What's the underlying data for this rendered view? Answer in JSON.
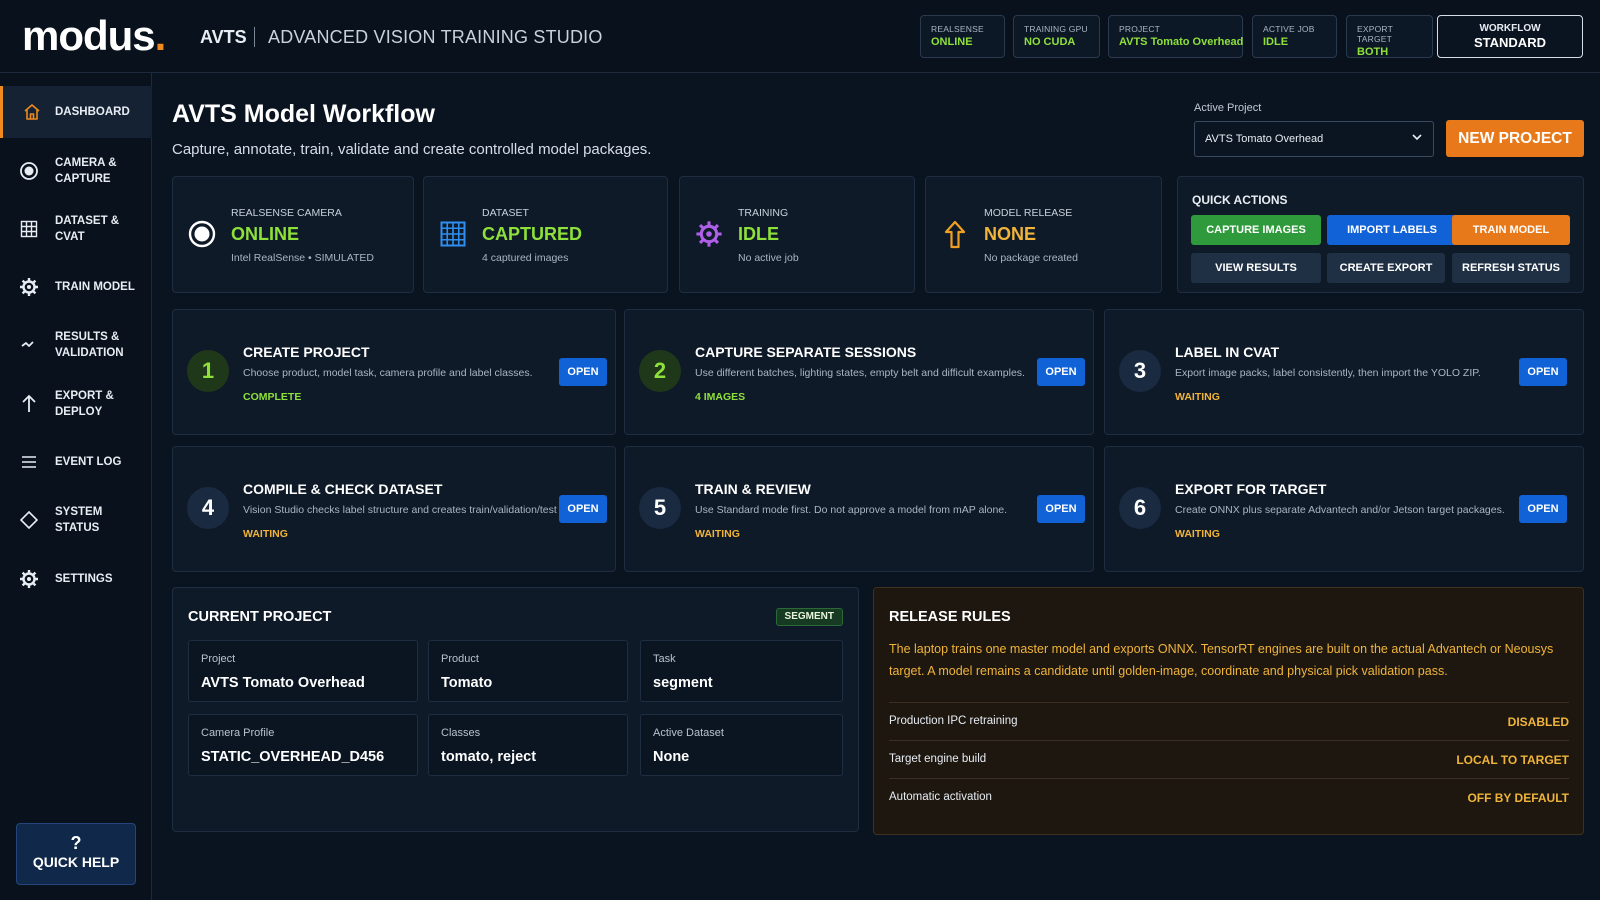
{
  "brand": {
    "logo": "modus",
    "logo_dot": ".",
    "app_name": "AVTS",
    "app_subtitle": "ADVANCED VISION TRAINING STUDIO"
  },
  "topbar": {
    "pills": [
      {
        "label": "REALSENSE",
        "value": "ONLINE"
      },
      {
        "label": "TRAINING GPU",
        "value": "NO CUDA"
      },
      {
        "label": "PROJECT",
        "value": "AVTS Tomato Overhead"
      },
      {
        "label": "ACTIVE JOB",
        "value": "IDLE"
      },
      {
        "label": "EXPORT TARGET",
        "value": "BOTH"
      }
    ],
    "workflow": {
      "label": "WORKFLOW",
      "value": "STANDARD"
    }
  },
  "sidebar": {
    "items": [
      {
        "label": "DASHBOARD",
        "icon": "home-icon",
        "active": true
      },
      {
        "label": "CAMERA & CAPTURE",
        "icon": "camera-icon"
      },
      {
        "label": "DATASET & CVAT",
        "icon": "grid-icon"
      },
      {
        "label": "TRAIN MODEL",
        "icon": "gear-icon"
      },
      {
        "label": "RESULTS & VALIDATION",
        "icon": "chart-icon"
      },
      {
        "label": "EXPORT & DEPLOY",
        "icon": "upload-arrow-icon"
      },
      {
        "label": "EVENT LOG",
        "icon": "list-icon"
      },
      {
        "label": "SYSTEM STATUS",
        "icon": "diamond-icon"
      },
      {
        "label": "SETTINGS",
        "icon": "gear-icon"
      }
    ],
    "quick_help": {
      "icon": "?",
      "label": "QUICK HELP"
    }
  },
  "header": {
    "title": "AVTS Model Workflow",
    "subtitle": "Capture, annotate, train, validate and create controlled model packages.",
    "active_project_label": "Active Project",
    "active_project_value": "AVTS Tomato Overhead",
    "new_project_label": "NEW PROJECT"
  },
  "status_cards": [
    {
      "label": "REALSENSE CAMERA",
      "value": "ONLINE",
      "sub": "Intel RealSense • SIMULATED",
      "icon": "camera-icon",
      "color": "#8ee03a"
    },
    {
      "label": "DATASET",
      "value": "CAPTURED",
      "sub": "4 captured images",
      "icon": "grid-icon",
      "color": "#8ee03a"
    },
    {
      "label": "TRAINING",
      "value": "IDLE",
      "sub": "No active job",
      "icon": "gear-icon",
      "color": "#8ee03a"
    },
    {
      "label": "MODEL RELEASE",
      "value": "NONE",
      "sub": "No package created",
      "icon": "upload-arrow-icon",
      "color": "#f0b43a"
    }
  ],
  "quick_actions": {
    "title": "QUICK ACTIONS",
    "buttons": [
      {
        "label": "CAPTURE IMAGES",
        "color": "#2f9a3c"
      },
      {
        "label": "IMPORT LABELS",
        "color": "#1062d6"
      },
      {
        "label": "TRAIN MODEL",
        "color": "#e8791a"
      },
      {
        "label": "VIEW RESULTS",
        "color": "#1f3045"
      },
      {
        "label": "CREATE EXPORT",
        "color": "#1f3045"
      },
      {
        "label": "REFRESH STATUS",
        "color": "#1f3045"
      }
    ]
  },
  "steps": [
    {
      "num": "1",
      "title": "CREATE PROJECT",
      "desc": "Choose product, model task, camera profile and label classes.",
      "status": "COMPLETE",
      "status_color": "#8ee03a",
      "done": true,
      "open": "OPEN"
    },
    {
      "num": "2",
      "title": "CAPTURE SEPARATE SESSIONS",
      "desc": "Use different batches, lighting states, empty belt and difficult examples.",
      "status": "4 IMAGES",
      "status_color": "#8ee03a",
      "done": true,
      "open": "OPEN"
    },
    {
      "num": "3",
      "title": "LABEL IN CVAT",
      "desc": "Export image packs, label consistently, then import the YOLO ZIP.",
      "status": "WAITING",
      "status_color": "#f0b43a",
      "done": false,
      "open": "OPEN"
    },
    {
      "num": "4",
      "title": "COMPILE & CHECK DATASET",
      "desc": "Vision Studio checks label structure and creates train/validation/test splits.",
      "status": "WAITING",
      "status_color": "#f0b43a",
      "done": false,
      "open": "OPEN"
    },
    {
      "num": "5",
      "title": "TRAIN & REVIEW",
      "desc": "Use Standard mode first. Do not approve a model from mAP alone.",
      "status": "WAITING",
      "status_color": "#f0b43a",
      "done": false,
      "open": "OPEN"
    },
    {
      "num": "6",
      "title": "EXPORT FOR TARGET",
      "desc": "Create ONNX plus separate Advantech and/or Jetson target packages.",
      "status": "WAITING",
      "status_color": "#f0b43a",
      "done": false,
      "open": "OPEN"
    }
  ],
  "current_project": {
    "title": "CURRENT PROJECT",
    "badge": "SEGMENT",
    "fields": [
      {
        "label": "Project",
        "value": "AVTS Tomato Overhead"
      },
      {
        "label": "Product",
        "value": "Tomato"
      },
      {
        "label": "Task",
        "value": "segment"
      },
      {
        "label": "Camera Profile",
        "value": "STATIC_OVERHEAD_D456"
      },
      {
        "label": "Classes",
        "value": "tomato, reject"
      },
      {
        "label": "Active Dataset",
        "value": "None"
      }
    ]
  },
  "release_rules": {
    "title": "RELEASE RULES",
    "text": "The laptop trains one master model and exports ONNX. TensorRT engines are built on the actual Advantech or Neousys target. A model remains a candidate until golden-image, coordinate and physical pick validation pass.",
    "rows": [
      {
        "key": "Production IPC retraining",
        "value": "DISABLED"
      },
      {
        "key": "Target engine build",
        "value": "LOCAL TO TARGET"
      },
      {
        "key": "Automatic activation",
        "value": "OFF BY DEFAULT"
      }
    ]
  }
}
